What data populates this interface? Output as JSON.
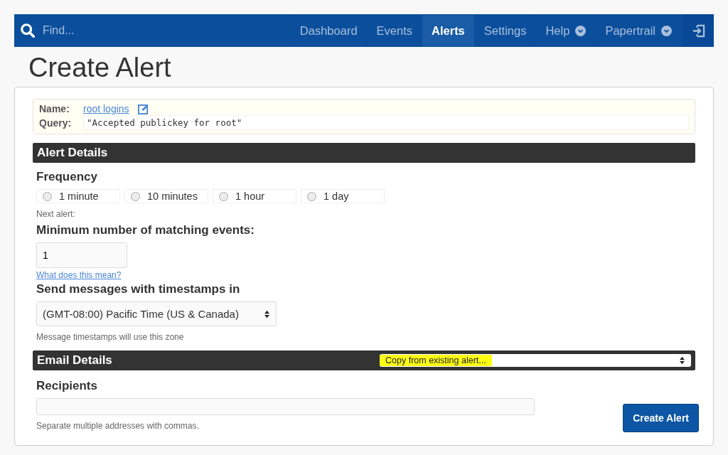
{
  "navbar": {
    "search": {
      "placeholder": "Find..."
    },
    "items": [
      {
        "label": "Dashboard",
        "selected": false,
        "dropdown": false
      },
      {
        "label": "Events",
        "selected": false,
        "dropdown": false
      },
      {
        "label": "Alerts",
        "selected": true,
        "dropdown": false
      },
      {
        "label": "Settings",
        "selected": false,
        "dropdown": false
      },
      {
        "label": "Help",
        "selected": false,
        "dropdown": true
      },
      {
        "label": "Papertrail",
        "selected": false,
        "dropdown": true
      }
    ]
  },
  "page_title": "Create Alert",
  "summary": {
    "name_label": "Name:",
    "name": "root logins",
    "query_label": "Query:",
    "query": "\"Accepted publickey for root\""
  },
  "alert_details": {
    "heading": "Alert Details",
    "frequency_label": "Frequency",
    "frequencies": [
      {
        "label": "1 minute",
        "selected": false
      },
      {
        "label": "10 minutes",
        "selected": false
      },
      {
        "label": "1 hour",
        "selected": false
      },
      {
        "label": "1 day",
        "selected": false
      }
    ],
    "next_alert": "Next alert:",
    "min_label": "Minimum number of matching events:",
    "min_value": "1",
    "help_link": "What does this mean?",
    "timezone_label": "Send messages with timestamps in",
    "timezone": "(GMT-08:00) Pacific Time (US & Canada)",
    "timezone_hint": "Message timestamps will use this zone"
  },
  "email_details": {
    "heading": "Email Details",
    "copy_select": "Copy from existing alert...",
    "recipients_label": "Recipients",
    "recipients_hint": "Separate multiple addresses with commas."
  },
  "submit": "Create Alert"
}
